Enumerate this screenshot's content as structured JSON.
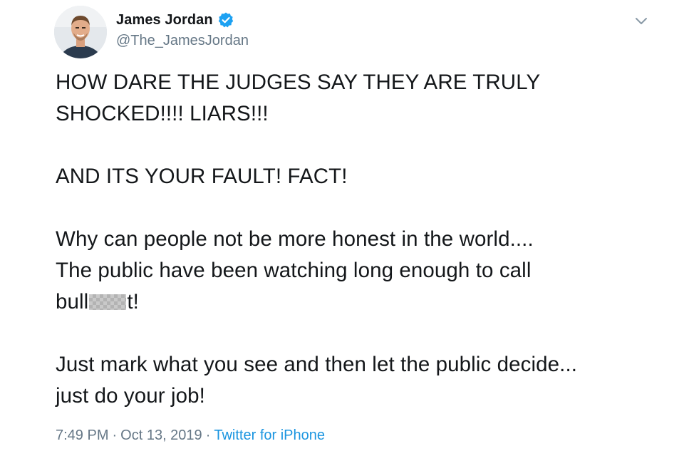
{
  "author": {
    "display_name": "James Jordan",
    "handle": "@The_JamesJordan",
    "verified": true,
    "verified_color": "#1da1f2"
  },
  "tweet": {
    "line1": "HOW DARE THE JUDGES SAY THEY ARE TRULY",
    "line2": "SHOCKED!!!! LIARS!!!",
    "line3": "AND ITS YOUR FAULT! FACT!",
    "line4": "Why can people not be more honest in the world....",
    "line5": "The public have been watching long enough to call",
    "line6_start": "bull",
    "line6_end": "t!",
    "line7": "Just mark what you see and then let the public decide...",
    "line8": "just do your job!"
  },
  "meta": {
    "time": "7:49 PM",
    "separator": "·",
    "date": "Oct 13, 2019",
    "source": "Twitter for iPhone",
    "source_color": "#1b95e0"
  },
  "icons": {
    "avatar": "profile-photo",
    "verified": "verified-badge-icon",
    "menu": "chevron-down-icon"
  }
}
